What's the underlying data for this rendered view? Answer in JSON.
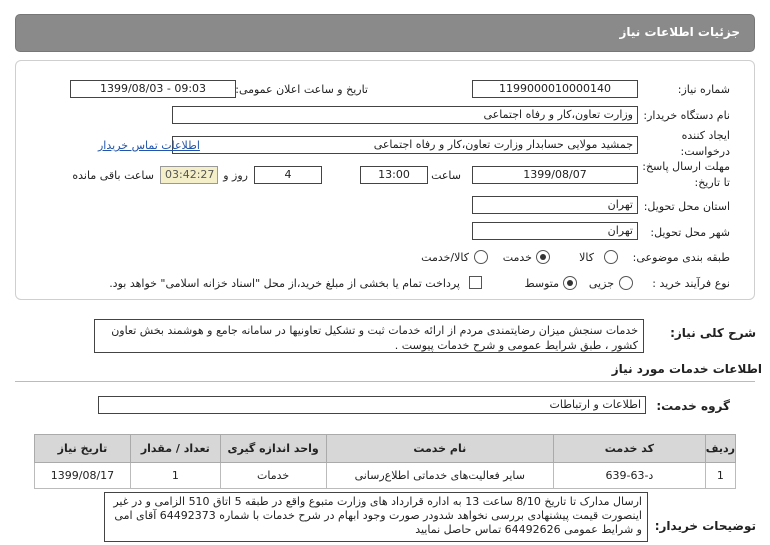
{
  "page_title": "جزئیات اطلاعات نیاز",
  "fields": {
    "need_number_label": "شماره نیاز:",
    "need_number": "1199000010000140",
    "announce_label": "تاریخ و ساعت اعلان عمومی:",
    "announce_value": "1399/08/03 - 09:03",
    "buyer_org_label": "نام دستگاه خریدار:",
    "buyer_org": "وزارت تعاون،کار و رفاه اجتماعی",
    "creator_label_1": "ایجاد کننده",
    "creator_label_2": "درخواست:",
    "creator": "جمشید مولایی حسابدار وزارت تعاون،کار و رفاه اجتماعی",
    "contact_link": "اطلاعات تماس خریدار",
    "deadline_label_1": "مهلت ارسال پاسخ:",
    "deadline_label_2": "تا تاریخ:",
    "deadline_date": "1399/08/07",
    "time_label": "ساعت",
    "deadline_time": "13:00",
    "days_value": "4",
    "days_label": "روز و",
    "remaining_time": "03:42:27",
    "remaining_label": "ساعت باقی مانده",
    "province_label": "استان محل تحویل:",
    "province": "تهران",
    "city_label": "شهر محل تحویل:",
    "city": "تهران",
    "category_label": "طبقه بندی موضوعی:",
    "category_options": [
      "کالا",
      "خدمت",
      "کالا/خدمت"
    ],
    "category_selected": "خدمت",
    "process_label": "نوع فرآیند خرید :",
    "process_options": [
      "جزیی",
      "متوسط"
    ],
    "process_selected": "متوسط",
    "payment_note": "پرداخت تمام یا بخشی از مبلغ خرید،از محل \"اسناد خزانه اسلامی\" خواهد بود."
  },
  "general_desc_label": "شرح کلی نیاز:",
  "general_desc": "خدمات سنجش میزان رضایتمندی مردم از ارائه خدمات ثبت و تشکیل تعاونیها در سامانه جامع و هوشمند بخش تعاون کشور ، طبق شرایط عمومی و شرح خدمات پیوست .",
  "services_section_title": "اطلاعات خدمات مورد نیاز",
  "service_group_label": "گروه خدمت:",
  "service_group": "اطلاعات و ارتباطات",
  "table": {
    "headers": [
      "ردیف",
      "کد خدمت",
      "نام خدمت",
      "واحد اندازه گیری",
      "تعداد / مقدار",
      "تاریخ نیاز"
    ],
    "rows": [
      [
        "1",
        "د-63-639",
        "سایر فعالیت‌های خدماتی اطلاع‌رسانی",
        "خدمات",
        "1",
        "1399/08/17"
      ]
    ]
  },
  "buyer_notes_label": "توضیحات خریدار:",
  "buyer_notes": "ارسال مدارک تا تاریخ 8/10 ساعت 13 به اداره قرارداد های وزارت متبوع واقع در طبقه 5 اتاق 510 الزامی و در غیر اینصورت قیمت پیشنهادی بررسی نخواهد شدودر صورت وجود ابهام در شرح خدمات با شماره 64492373 آقای امی و شرایط عمومی 64492626 تماس حاصل نمایید"
}
